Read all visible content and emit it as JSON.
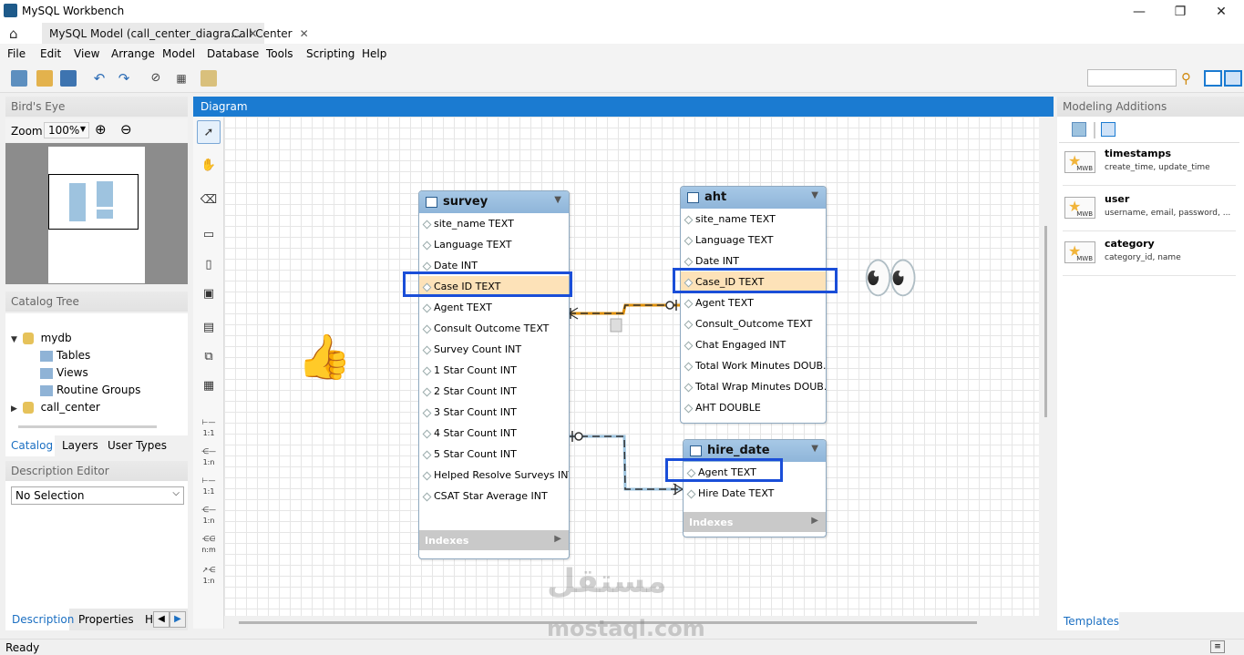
{
  "window": {
    "title": "MySQL Workbench",
    "minimize": "—",
    "maximize": "❐",
    "close": "✕"
  },
  "tabs": [
    {
      "label": "MySQL Model (call_center_diagra...",
      "close": "✕"
    },
    {
      "label": "Call Center",
      "close": "✕"
    }
  ],
  "menu": [
    "File",
    "Edit",
    "View",
    "Arrange",
    "Model",
    "Database",
    "Tools",
    "Scripting",
    "Help"
  ],
  "left": {
    "birds_eye": "Bird's Eye",
    "zoom_label": "Zoom:",
    "zoom_value": "100%",
    "catalog_tree": "Catalog Tree",
    "tree": {
      "db1": "mydb",
      "children": [
        "Tables",
        "Views",
        "Routine Groups"
      ],
      "db2": "call_center"
    },
    "tabs": [
      "Catalog",
      "Layers",
      "User Types"
    ],
    "description_editor": "Description Editor",
    "selection": "No Selection",
    "bottom_tabs": [
      "Description",
      "Properties",
      "H"
    ]
  },
  "diagram": {
    "title": "Diagram",
    "palette_labels": [
      "1:1",
      "1:n",
      "1:1",
      "1:n",
      "n:m",
      "1:n"
    ],
    "tables": {
      "survey": {
        "name": "survey",
        "columns": [
          "site_name TEXT",
          "Language TEXT",
          "Date INT",
          "Case ID TEXT",
          "Agent TEXT",
          "Consult Outcome TEXT",
          "Survey Count INT",
          "1 Star Count INT",
          "2 Star Count INT",
          "3 Star Count INT",
          "4 Star Count INT",
          "5 Star Count INT",
          "Helped Resolve Surveys INT",
          "CSAT Star Average INT"
        ],
        "indexes": "Indexes"
      },
      "aht": {
        "name": "aht",
        "columns": [
          "site_name TEXT",
          "Language TEXT",
          "Date INT",
          "Case_ID TEXT",
          "Agent TEXT",
          "Consult_Outcome TEXT",
          "Chat Engaged INT",
          "Total Work Minutes DOUB...",
          "Total Wrap Minutes DOUB...",
          "AHT DOUBLE"
        ]
      },
      "hire_date": {
        "name": "hire_date",
        "columns": [
          "Agent TEXT",
          "Hire Date TEXT"
        ],
        "indexes": "Indexes"
      }
    },
    "emoji_thumb": "👍",
    "emoji_eyes": "👀"
  },
  "right": {
    "title": "Modeling Additions",
    "items": [
      {
        "title": "timestamps",
        "desc": "create_time, update_time"
      },
      {
        "title": "user",
        "desc": "username, email, password, ..."
      },
      {
        "title": "category",
        "desc": "category_id, name"
      }
    ],
    "badge": "MWB",
    "templates_tab": "Templates"
  },
  "status": "Ready",
  "watermark": {
    "ar": "مستقل",
    "en": "mostaql.com"
  },
  "colors": {
    "accent": "#1b7bd1",
    "highlight": "#fde2b8",
    "frame": "#1a4ed8",
    "relation_orange": "#e0900a",
    "relation_blue": "#6a9fbf"
  }
}
